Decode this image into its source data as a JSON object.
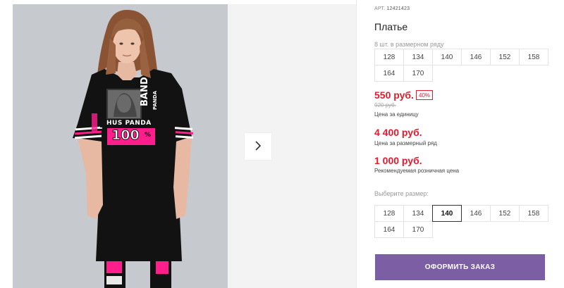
{
  "product": {
    "article_label": "АРТ.",
    "article_number": "12421423",
    "title": "Платье",
    "pack_note": "8 шт. в размерном ряду",
    "print_text": {
      "band": "BAND",
      "panda": "PANDA",
      "hus_panda": "HUS PANDA",
      "percent": "100",
      "percent_sign": "%"
    }
  },
  "pack_sizes": [
    "128",
    "134",
    "140",
    "146",
    "152",
    "158",
    "164",
    "170"
  ],
  "prices": {
    "unit_price": "550 руб.",
    "discount": "40%",
    "old_price": "920 руб.",
    "unit_label": "Цена за единицу",
    "set_price": "4 400 руб.",
    "set_label": "Цена за размерный ряд",
    "rrp_price": "1 000 руб.",
    "rrp_label": "Рекомендуемая розничная цена"
  },
  "size_selector": {
    "label": "Выберите размер:",
    "sizes": [
      "128",
      "134",
      "140",
      "146",
      "152",
      "158",
      "164",
      "170"
    ],
    "selected": "140"
  },
  "order_button_label": "ОФОРМИТЬ ЗАКАЗ",
  "colors": {
    "price_red": "#e8192c",
    "button_purple": "#7b5ea3",
    "neon_pink": "#ff1e8c"
  },
  "icons": {
    "next": "chevron-right-icon"
  }
}
